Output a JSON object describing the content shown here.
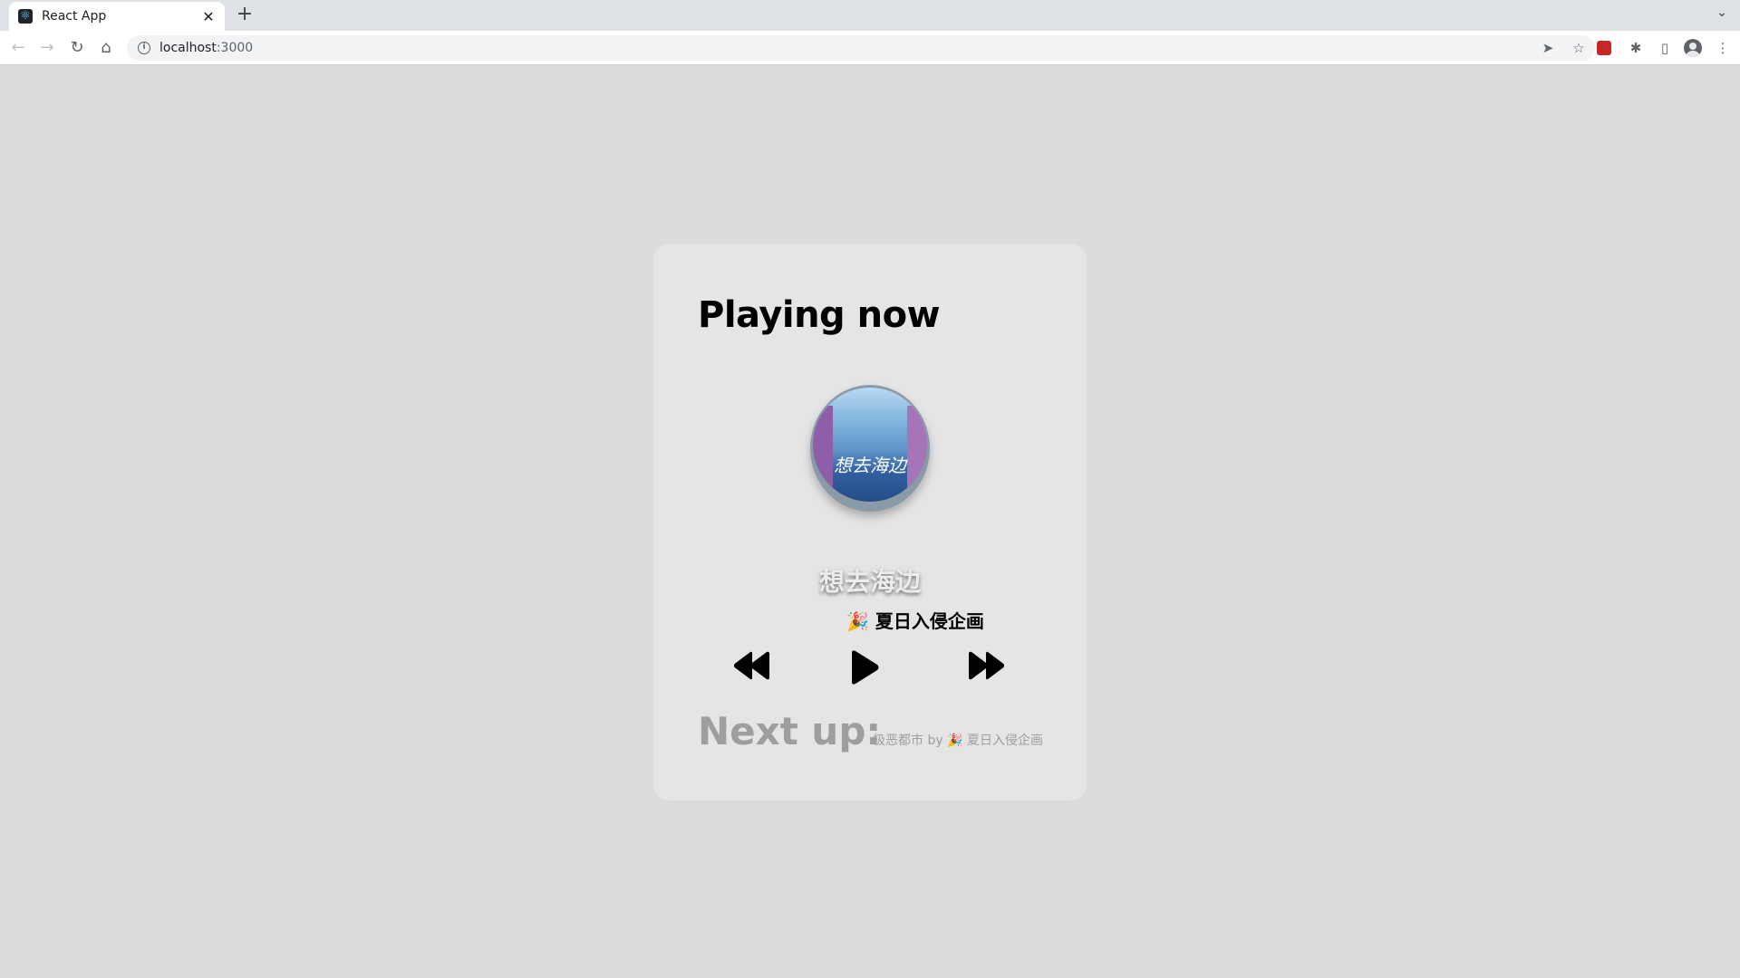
{
  "browser": {
    "tab_title": "React App",
    "url_host": "localhost",
    "url_port": ":3000"
  },
  "player": {
    "heading": "Playing now",
    "cover_text": "想去海边",
    "song_title": "想去海边",
    "artist": "🎉 夏日入侵企画",
    "next_label": "Next up:",
    "next_track": "极恶都市 by 🎉 夏日入侵企画"
  },
  "icons": {
    "rewind": "rewind-icon",
    "play": "play-icon",
    "fast_forward": "fast-forward-icon"
  }
}
